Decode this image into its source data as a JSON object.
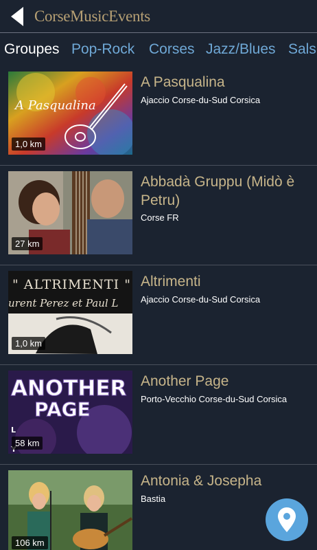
{
  "header": {
    "logo_text": "CorseMusicEvents",
    "back_icon": "back-arrow-icon"
  },
  "tabs": [
    {
      "label": "Groupes",
      "active": true
    },
    {
      "label": "Pop-Rock",
      "active": false
    },
    {
      "label": "Corses",
      "active": false
    },
    {
      "label": "Jazz/Blues",
      "active": false
    },
    {
      "label": "Sals",
      "active": false
    }
  ],
  "list": [
    {
      "title": "A Pasqualina",
      "location": "Ajaccio Corse-du-Sud Corsica",
      "distance": "1,0 km",
      "image_text": "A Pasqualina"
    },
    {
      "title": "Abbadà Gruppu (Midò è Petru)",
      "location": "Corse FR",
      "distance": "27 km"
    },
    {
      "title": "Altrimenti",
      "location": "Ajaccio Corse-du-Sud Corsica",
      "distance": "1,0 km",
      "image_text": "\" ALTRIMENTI \"",
      "image_subtext": "urent Perez et Paul L"
    },
    {
      "title": "Another Page",
      "location": "Porto-Vecchio Corse-du-Sud Corsica",
      "distance": "58 km",
      "image_text": "ANOTHER",
      "image_text2": "PAGE",
      "image_side": "L\nY"
    },
    {
      "title": "Antonia & Josepha",
      "location": "Bastia",
      "distance": "106 km"
    }
  ],
  "map_button": {
    "icon": "map-pin-icon"
  },
  "colors": {
    "background": "#1b2330",
    "title": "#c7b58a",
    "tab_link": "#6fa8d6",
    "fab": "#5aa5dd"
  }
}
